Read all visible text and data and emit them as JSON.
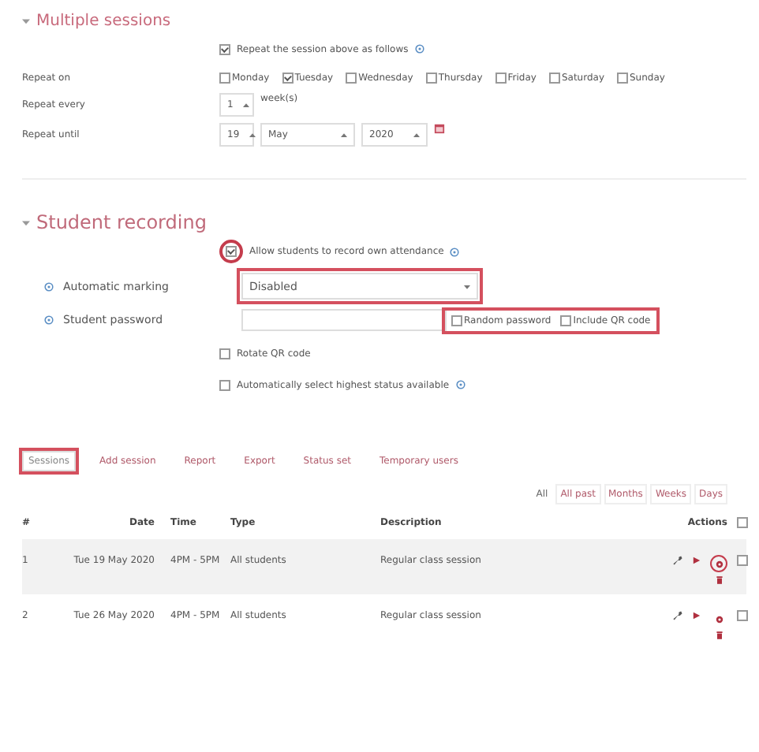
{
  "multiple_sessions": {
    "title": "Multiple sessions",
    "repeat_checkbox": {
      "label": "Repeat the session above as follows",
      "checked": true
    },
    "repeat_on": {
      "label": "Repeat on",
      "days": [
        {
          "label": "Monday",
          "checked": false
        },
        {
          "label": "Tuesday",
          "checked": true
        },
        {
          "label": "Wednesday",
          "checked": false
        },
        {
          "label": "Thursday",
          "checked": false
        },
        {
          "label": "Friday",
          "checked": false
        },
        {
          "label": "Saturday",
          "checked": false
        },
        {
          "label": "Sunday",
          "checked": false
        }
      ]
    },
    "repeat_every": {
      "label": "Repeat every",
      "value": "1",
      "unit": "week(s)"
    },
    "repeat_until": {
      "label": "Repeat until",
      "day": "19",
      "month": "May",
      "year": "2020"
    }
  },
  "student_recording": {
    "title": "Student recording",
    "allow": {
      "label": "Allow students to record own attendance",
      "checked": true,
      "highlighted": true
    },
    "automatic_marking": {
      "label": "Automatic marking",
      "value": "Disabled",
      "highlighted": true
    },
    "student_password": {
      "label": "Student password",
      "highlighted": true,
      "options": [
        {
          "label": "Random password",
          "checked": false
        },
        {
          "label": "Include QR code",
          "checked": false
        }
      ]
    },
    "checkboxes": [
      {
        "label": "Rotate QR code",
        "checked": false,
        "help": false
      },
      {
        "label": "Automatically select highest status available",
        "checked": false,
        "help": true
      }
    ]
  },
  "tabs": [
    {
      "label": "Sessions",
      "selected": true
    },
    {
      "label": "Add session",
      "selected": false
    },
    {
      "label": "Report",
      "selected": false
    },
    {
      "label": "Export",
      "selected": false
    },
    {
      "label": "Status set",
      "selected": false
    },
    {
      "label": "Temporary users",
      "selected": false
    }
  ],
  "period_filters": [
    {
      "label": "All",
      "selected": true
    },
    {
      "label": "All past",
      "selected": false
    },
    {
      "label": "Months",
      "selected": false
    },
    {
      "label": "Weeks",
      "selected": false
    },
    {
      "label": "Days",
      "selected": false
    }
  ],
  "table": {
    "select_all_checked": false,
    "columns": [
      "#",
      "Date",
      "Time",
      "Type",
      "Description",
      "Actions"
    ],
    "rows": [
      {
        "number": "1",
        "date": "Tue 19 May 2020",
        "time": "4PM - 5PM",
        "type": "All students",
        "description": "Regular class session",
        "shaded": true,
        "highlighted": true,
        "checked": false
      },
      {
        "number": "2",
        "date": "Tue 26 May 2020",
        "time": "4PM - 5PM",
        "type": "All students",
        "description": "Regular class session",
        "shaded": false,
        "highlighted": false,
        "checked": false
      }
    ]
  }
}
